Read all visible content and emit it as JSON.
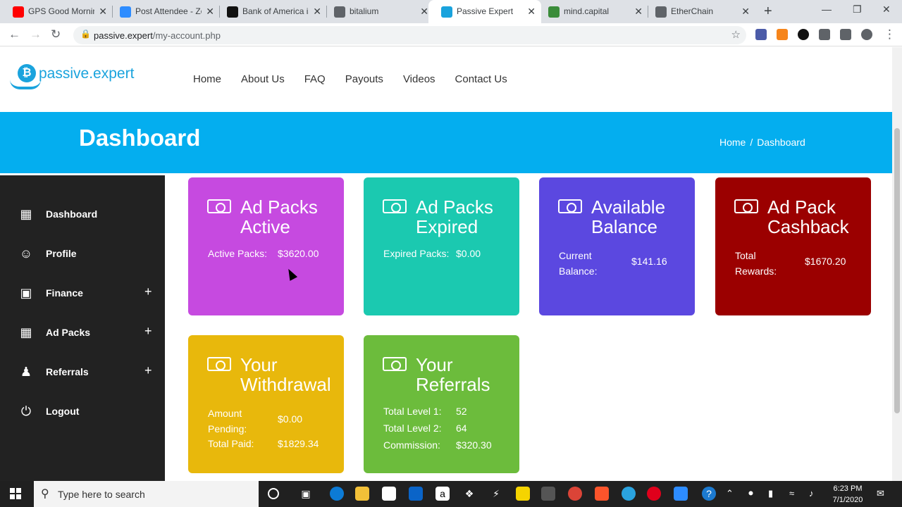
{
  "browser": {
    "tabs": [
      {
        "title": "GPS Good Mornin",
        "favicon_color": "#ff0000",
        "active": false
      },
      {
        "title": "Post Attendee - Zo",
        "favicon_color": "#2d8cff",
        "active": false
      },
      {
        "title": "Bank of America is",
        "favicon_color": "#111111",
        "active": false
      },
      {
        "title": "bitalium",
        "favicon_color": "#5f6368",
        "active": false
      },
      {
        "title": "Passive Expert",
        "favicon_color": "#1aa3dd",
        "active": true
      },
      {
        "title": "mind.capital",
        "favicon_color": "#3a8c3a",
        "active": false
      },
      {
        "title": "EtherChain",
        "favicon_color": "#5f6368",
        "active": false
      }
    ],
    "close_glyph": "✕",
    "new_tab_glyph": "+",
    "url_host": "passive.expert",
    "url_path": "/my-account.php"
  },
  "site": {
    "logo_text": "passive.expert",
    "logo_coin": "₿",
    "nav": [
      "Home",
      "About Us",
      "FAQ",
      "Payouts",
      "Videos",
      "Contact Us"
    ],
    "page_title": "Dashboard",
    "breadcrumb": {
      "home": "Home",
      "separator": "/",
      "current": "Dashboard"
    }
  },
  "sidebar": {
    "items": [
      {
        "label": "Dashboard",
        "icon": "dashboard-icon",
        "expandable": false
      },
      {
        "label": "Profile",
        "icon": "user-icon",
        "expandable": false
      },
      {
        "label": "Finance",
        "icon": "wallet-icon",
        "expandable": true
      },
      {
        "label": "Ad Packs",
        "icon": "windows-grid-icon",
        "expandable": true
      },
      {
        "label": "Referrals",
        "icon": "person-icon",
        "expandable": true
      },
      {
        "label": "Logout",
        "icon": "power-icon",
        "expandable": false
      }
    ],
    "expand_glyph": "+"
  },
  "cards": [
    {
      "title": "Ad Packs Active",
      "title_lines": [
        "Ad Packs",
        "Active"
      ],
      "color": "#c64ae0",
      "rows": [
        {
          "label": "Active Packs:",
          "value": "$3620.00"
        }
      ]
    },
    {
      "title": "Ad Packs Expired",
      "title_lines": [
        "Ad Packs",
        "Expired"
      ],
      "color": "#1bc9b0",
      "rows": [
        {
          "label": "Expired Packs:",
          "value": "$0.00"
        }
      ]
    },
    {
      "title": "Available Balance",
      "title_lines": [
        "Available",
        "Balance"
      ],
      "color": "#5b48e0",
      "rows": [
        {
          "label": "Current Balance:",
          "value": "$141.16"
        }
      ]
    },
    {
      "title": "Ad Pack Cashback",
      "title_lines": [
        "Ad Pack",
        "Cashback"
      ],
      "color": "#9b0000",
      "rows": [
        {
          "label": "Total Rewards:",
          "value": "$1670.20"
        }
      ]
    },
    {
      "title": "Your Withdrawal",
      "title_lines": [
        "Your",
        "Withdrawal"
      ],
      "color": "#e8b80c",
      "rows": [
        {
          "label": "Amount Pending:",
          "value": "$0.00"
        },
        {
          "label": "Total Paid:",
          "value": "$1829.34"
        }
      ]
    },
    {
      "title": "Your Referrals",
      "title_lines": [
        "Your",
        "Referrals"
      ],
      "color": "#6cbc3c",
      "rows": [
        {
          "label": "Total Level 1:",
          "value": "52"
        },
        {
          "label": "Total Level 2:",
          "value": "64"
        },
        {
          "label": "Commission:",
          "value": "$320.30"
        }
      ]
    }
  ],
  "taskbar": {
    "search_placeholder": "Type here to search",
    "time": "6:23 PM",
    "date": "7/1/2020"
  }
}
